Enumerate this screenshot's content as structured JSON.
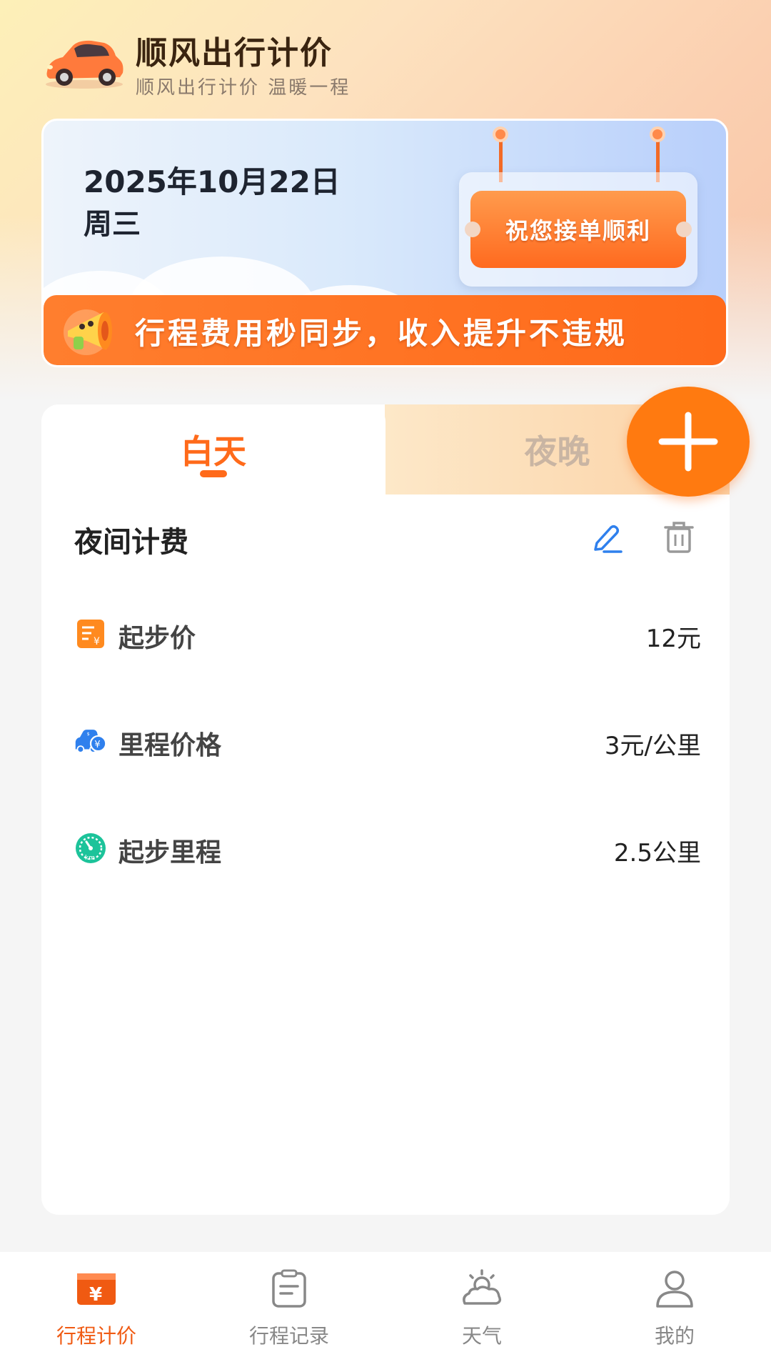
{
  "header": {
    "title": "顺风出行计价",
    "subtitle": "顺风出行计价 温暖一程"
  },
  "banner": {
    "date": "2025年10月22日",
    "weekday": "周三",
    "sign_text": "祝您接单顺利",
    "strip_text": "行程费用秒同步，收入提升不违规"
  },
  "tabs": [
    {
      "label": "白天",
      "active": true
    },
    {
      "label": "夜晚",
      "active": false
    }
  ],
  "fee_section": {
    "title": "夜间计费",
    "items": [
      {
        "icon": "start-price-icon",
        "label": "起步价",
        "value": "12元"
      },
      {
        "icon": "mileage-price-icon",
        "label": "里程价格",
        "value": "3元/公里"
      },
      {
        "icon": "start-mileage-icon",
        "label": "起步里程",
        "value": "2.5公里"
      }
    ]
  },
  "bottom_nav": [
    {
      "icon": "fare-icon",
      "label": "行程计价",
      "active": true
    },
    {
      "icon": "record-icon",
      "label": "行程记录",
      "active": false
    },
    {
      "icon": "weather-icon",
      "label": "天气",
      "active": false
    },
    {
      "icon": "profile-icon",
      "label": "我的",
      "active": false
    }
  ],
  "colors": {
    "accent": "#ff6a1a",
    "fab": "#ff7a10",
    "edit_icon": "#2f80ed",
    "mileage_icon": "#2f80ed",
    "start_mileage_icon": "#1cc39a"
  }
}
